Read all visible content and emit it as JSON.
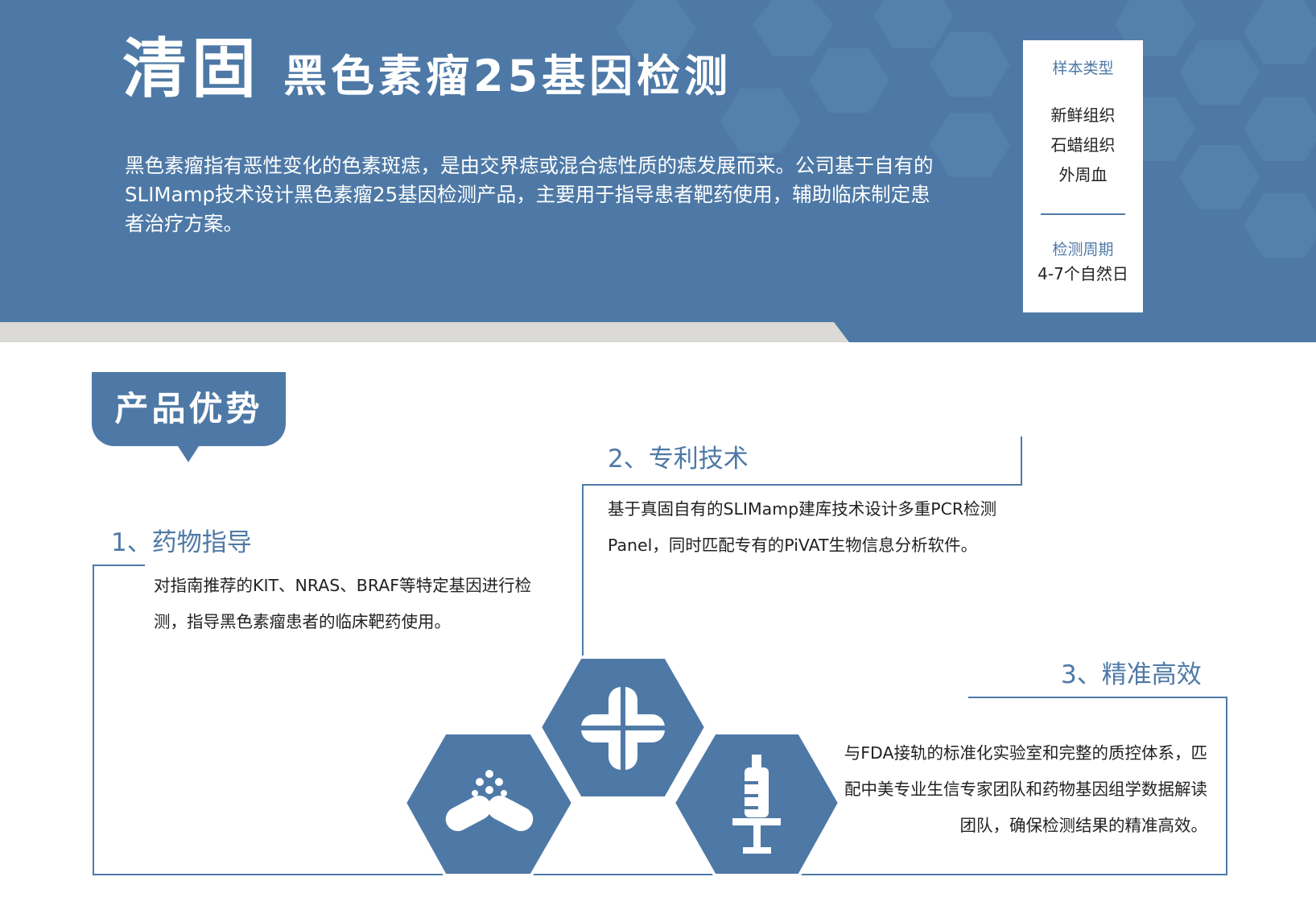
{
  "header": {
    "brand": "清固",
    "product": "黑色素瘤25基因检测",
    "intro": "黑色素瘤指有恶性变化的色素斑痣，是由交界痣或混合痣性质的痣发展而来。公司基于自有的SLIMamp技术设计黑色素瘤25基因检测产品，主要用于指导患者靶药使用，辅助临床制定患者治疗方案。"
  },
  "info_card": {
    "sample_label": "样本类型",
    "samples": [
      "新鲜组织",
      "石蜡组织",
      "外周血"
    ],
    "cycle_label": "检测周期",
    "cycle_value": "4-7个自然日"
  },
  "advantages": {
    "label": "产品优势",
    "items": [
      {
        "title": "1、药物指导",
        "text": "对指南推荐的KIT、NRAS、BRAF等特定基因进行检测，指导黑色素瘤患者的临床靶药使用。"
      },
      {
        "title": "2、专利技术",
        "text": "基于真固自有的SLIMamp建库技术设计多重PCR检测Panel，同时匹配专有的PiVAT生物信息分析软件。"
      },
      {
        "title": "3、精准高效",
        "text": "与FDA接轨的标准化实验室和完整的质控体系，匹配中美专业生信专家团队和药物基因组学数据解读团队，确保检测结果的精准高效。"
      }
    ]
  },
  "icons": [
    "capsule-icon",
    "medical-cross-icon",
    "syringe-icon"
  ],
  "colors": {
    "brand_blue": "#4e79a6",
    "stripe_gray": "#dcdad7",
    "text_dark": "#222222",
    "white": "#ffffff"
  }
}
